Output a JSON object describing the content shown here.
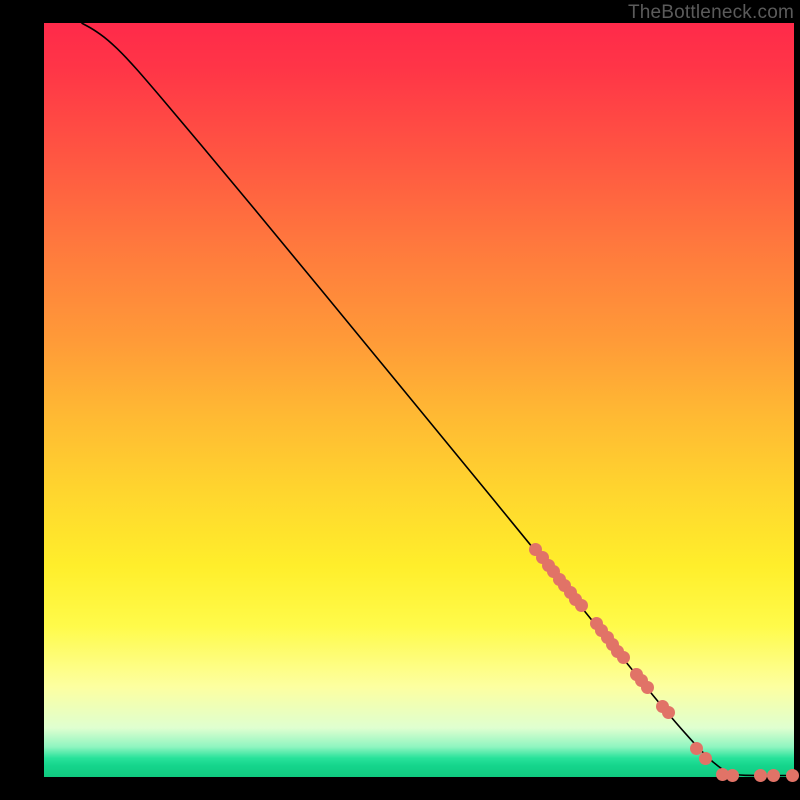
{
  "watermark": "TheBottleneck.com",
  "colors": {
    "point": "#e17367",
    "curve": "#000000",
    "background": "#000000"
  },
  "chart_data": {
    "type": "line",
    "title": "",
    "xlabel": "",
    "ylabel": "",
    "xlim": [
      0,
      100
    ],
    "ylim": [
      0,
      100
    ],
    "curve": [
      {
        "x": 5.0,
        "y": 100.0
      },
      {
        "x": 6.5,
        "y": 99.2
      },
      {
        "x": 8.5,
        "y": 97.8
      },
      {
        "x": 11.0,
        "y": 95.4
      },
      {
        "x": 14.0,
        "y": 92.0
      },
      {
        "x": 18.0,
        "y": 87.3
      },
      {
        "x": 24.0,
        "y": 80.2
      },
      {
        "x": 32.0,
        "y": 70.6
      },
      {
        "x": 42.0,
        "y": 58.5
      },
      {
        "x": 54.0,
        "y": 44.0
      },
      {
        "x": 66.0,
        "y": 29.4
      },
      {
        "x": 76.0,
        "y": 17.2
      },
      {
        "x": 83.0,
        "y": 8.6
      },
      {
        "x": 88.0,
        "y": 3.0
      },
      {
        "x": 90.5,
        "y": 0.9
      },
      {
        "x": 92.0,
        "y": 0.25
      },
      {
        "x": 95.0,
        "y": 0.2
      },
      {
        "x": 100.0,
        "y": 0.2
      }
    ],
    "series": [
      {
        "name": "points",
        "values": [
          {
            "x": 65.5,
            "y": 30.2
          },
          {
            "x": 66.4,
            "y": 29.1
          },
          {
            "x": 67.2,
            "y": 28.1
          },
          {
            "x": 67.9,
            "y": 27.2
          },
          {
            "x": 68.7,
            "y": 26.2
          },
          {
            "x": 69.4,
            "y": 25.4
          },
          {
            "x": 70.2,
            "y": 24.5
          },
          {
            "x": 70.9,
            "y": 23.6
          },
          {
            "x": 71.7,
            "y": 22.7
          },
          {
            "x": 73.6,
            "y": 20.3
          },
          {
            "x": 74.3,
            "y": 19.4
          },
          {
            "x": 75.1,
            "y": 18.5
          },
          {
            "x": 75.8,
            "y": 17.6
          },
          {
            "x": 76.5,
            "y": 16.7
          },
          {
            "x": 77.2,
            "y": 15.8
          },
          {
            "x": 79.0,
            "y": 13.6
          },
          {
            "x": 79.7,
            "y": 12.8
          },
          {
            "x": 80.4,
            "y": 11.9
          },
          {
            "x": 82.5,
            "y": 9.3
          },
          {
            "x": 83.2,
            "y": 8.5
          },
          {
            "x": 87.0,
            "y": 3.8
          },
          {
            "x": 88.2,
            "y": 2.4
          },
          {
            "x": 90.4,
            "y": 0.3
          },
          {
            "x": 91.8,
            "y": 0.2
          },
          {
            "x": 95.5,
            "y": 0.2
          },
          {
            "x": 97.3,
            "y": 0.2
          },
          {
            "x": 99.8,
            "y": 0.2
          }
        ]
      }
    ]
  }
}
